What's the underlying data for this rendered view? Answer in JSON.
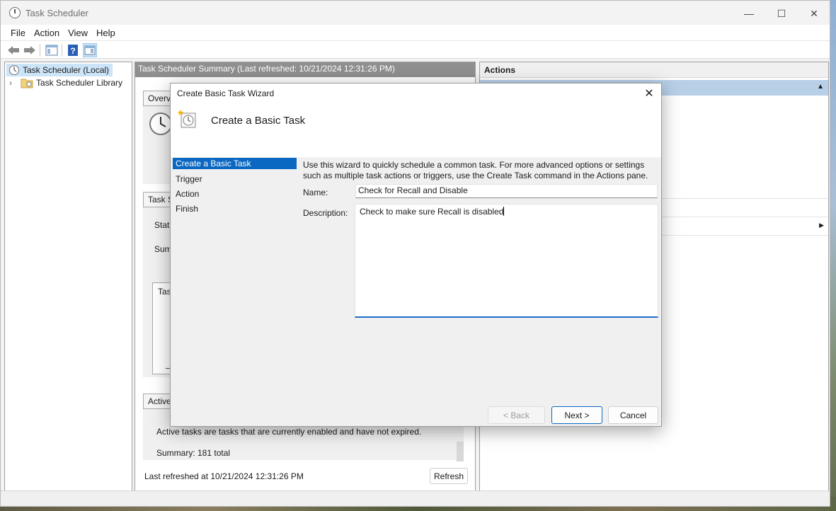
{
  "window": {
    "title": "Task Scheduler",
    "caption": {
      "minimize": "—",
      "maximize": "☐",
      "close": "✕"
    }
  },
  "menu": [
    "File",
    "Action",
    "View",
    "Help"
  ],
  "toolbar": {
    "icons": [
      "back-arrow-icon",
      "forward-arrow-icon",
      "show-hide-tree-icon",
      "help-icon",
      "show-hide-action-pane-icon"
    ]
  },
  "tree": {
    "root_label": "Task Scheduler (Local)",
    "library_label": "Task Scheduler Library",
    "expander": "›"
  },
  "middle": {
    "header": "Task Scheduler Summary (Last refreshed: 10/21/2024 12:31:26 PM)",
    "overview_title": "Overvi",
    "task_status_title": "Task S",
    "status_label": "Statu",
    "summary_label": "Sum",
    "tasks_label": "Tas",
    "active_title": "Active",
    "active_desc": "Active tasks are tasks that are currently enabled and have not expired.",
    "active_summary": "Summary: 181 total",
    "last_refreshed": "Last refreshed at 10/21/2024 12:31:26 PM",
    "refresh_button": "Refresh"
  },
  "actions": {
    "header": "Actions",
    "collapse_glyph": "▲",
    "submenu_glyph": "▶"
  },
  "dialog": {
    "title": "Create Basic Task Wizard",
    "heading": "Create a Basic Task",
    "steps": [
      "Create a Basic Task",
      "Trigger",
      "Action",
      "Finish"
    ],
    "active_step": 0,
    "intro_line1": "Use this wizard to quickly schedule a common task.  For more advanced options or settings",
    "intro_line2": "such as multiple task actions or triggers, use the Create Task command in the Actions pane.",
    "name_label": "Name:",
    "name_value": "Check for Recall and Disable",
    "description_label": "Description:",
    "description_value": "Check to make sure Recall is disabled",
    "buttons": {
      "back": "< Back",
      "next": "Next >",
      "cancel": "Cancel"
    },
    "close": "✕"
  },
  "colors": {
    "selection_blue": "#0a67c2",
    "tree_selection": "#cce4f7",
    "middle_header": "#8f8f8f",
    "actions_highlight": "#b8cfe8"
  }
}
